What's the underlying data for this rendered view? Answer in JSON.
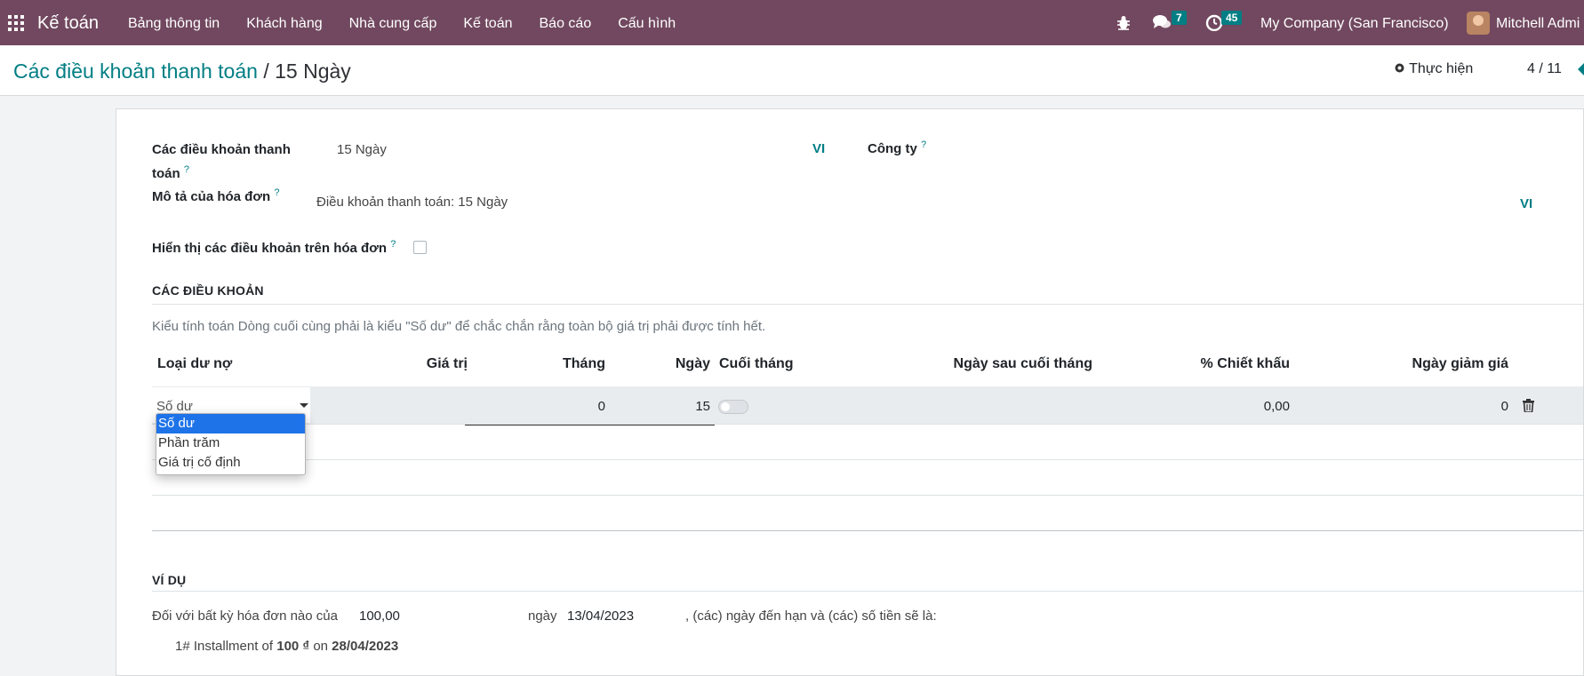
{
  "navbar": {
    "brand": "Kế toán",
    "menu": [
      "Bảng thông tin",
      "Khách hàng",
      "Nhà cung cấp",
      "Kế toán",
      "Báo cáo",
      "Cấu hình"
    ],
    "messages_count": "7",
    "activities_count": "45",
    "company": "My Company (San Francisco)",
    "user": "Mitchell Admi"
  },
  "control_panel": {
    "breadcrumb_parent": "Các điều khoản thanh toán",
    "breadcrumb_sep": "/",
    "breadcrumb_current": "15 Ngày",
    "action_label": "Thực hiện",
    "pager": "4 / 11"
  },
  "form": {
    "name_label_line1": "Các điều khoản thanh",
    "name_label_line2": "toán",
    "name_value": "15 Ngày",
    "lang_tag": "VI",
    "company_label": "Công ty",
    "description_label": "Mô tả của hóa đơn",
    "description_value": "Điều khoản thanh toán: 15 Ngày",
    "description_lang": "VI",
    "display_terms_label": "Hiển thị các điều khoản trên hóa đơn",
    "display_terms_checked": false,
    "help_mark": "?"
  },
  "terms": {
    "section_title": "CÁC ĐIỀU KHOẢN",
    "hint": "Kiểu tính toán Dòng cuối cùng phải là kiểu \"Số dư\" để chắc chắn rằng toàn bộ giá trị phải được tính hết.",
    "columns": [
      "Loại dư nợ",
      "Giá trị",
      "Tháng",
      "Ngày",
      "Cuối tháng",
      "Ngày sau cuối tháng",
      "% Chiết khấu",
      "Ngày giảm giá"
    ],
    "row": {
      "type": "Số dư",
      "months": "0",
      "days": "15",
      "end_of_month": false,
      "discount": "0,00",
      "discount_days": "0"
    },
    "dropdown_options": [
      "Số dư",
      "Phần trăm",
      "Giá trị cố định"
    ],
    "dropdown_selected": "Số dư"
  },
  "example": {
    "section_title": "VÍ DỤ",
    "prefix": "Đối với bất kỳ hóa đơn nào của",
    "amount": "100,00",
    "date_label": "ngày",
    "date": "13/04/2023",
    "suffix": ", (các) ngày đến hạn và (các) số tiền sẽ là:",
    "installment_prefix": "1# Installment of",
    "installment_amount": "100 ₫",
    "installment_on": "on",
    "installment_date": "28/04/2023"
  },
  "colors": {
    "navbar": "#71485f",
    "accent": "#017e84",
    "dropdown_active": "#1e73e8"
  }
}
